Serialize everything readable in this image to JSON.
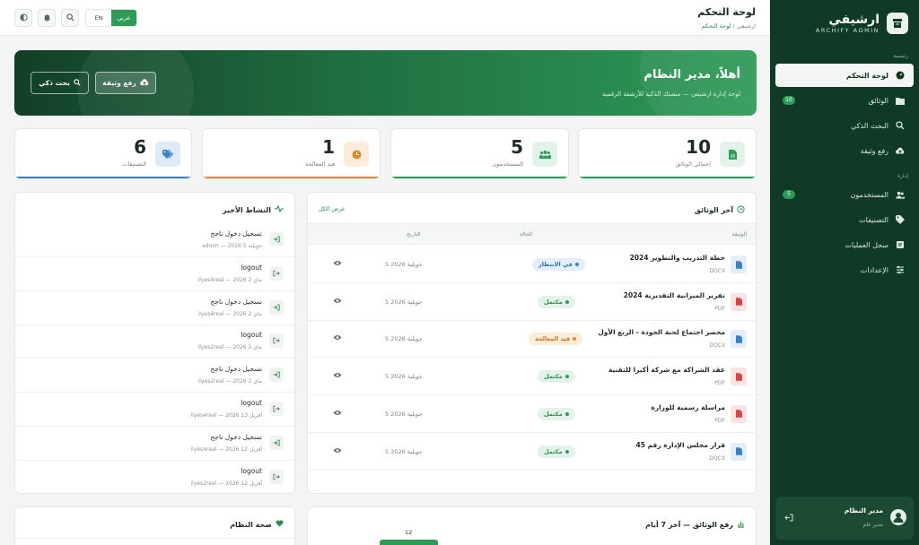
{
  "sidebar": {
    "brand_title": "ارشيفي",
    "brand_sub": "ARCHIFY ADMIN",
    "section_main": "رئيسية",
    "section_admin": "إدارة",
    "items": [
      {
        "label": "لوحة التحكم",
        "icon": "dashboard-icon",
        "active": true
      },
      {
        "label": "الوثائق",
        "icon": "folder-icon",
        "badge": "10"
      },
      {
        "label": "البحث الذكي",
        "icon": "search-icon"
      },
      {
        "label": "رفع وثيقة",
        "icon": "cloud-upload-icon"
      },
      {
        "label": "المستخدمون",
        "icon": "users-icon",
        "badge": "5"
      },
      {
        "label": "التصنيفات",
        "icon": "tag-icon"
      },
      {
        "label": "سجل العمليات",
        "icon": "log-icon"
      },
      {
        "label": "الإعدادات",
        "icon": "sliders-icon"
      }
    ],
    "user": {
      "name": "مدير النظام",
      "role": "مدير عام"
    }
  },
  "topbar": {
    "title": "لوحة التحكم",
    "breadcrumb_root": "ارشيفي",
    "breadcrumb_sep": "/",
    "breadcrumb_current": "لوحة التحكم",
    "lang_ar": "عربي",
    "lang_en": "EN"
  },
  "hero": {
    "title": "أهلاً، مدير النظام",
    "subtitle": "لوحة إدارة ارشيفي — منصتك الذكية للأرشفة الرقمية",
    "upload_label": "رفع وثيقة",
    "search_label": "بحث ذكي"
  },
  "stats": [
    {
      "value": "10",
      "label": "إجمالي الوثائق",
      "color": "#2f9b58",
      "bg": "#e4f3e9"
    },
    {
      "value": "5",
      "label": "المستخدمون",
      "color": "#2f9b58",
      "bg": "#e4f3e9"
    },
    {
      "value": "1",
      "label": "قيد المعالجة",
      "color": "#e08a2e",
      "bg": "#fcecd9"
    },
    {
      "value": "6",
      "label": "التصنيفات",
      "color": "#3b82c4",
      "bg": "#dfeaf7"
    }
  ],
  "documents": {
    "title": "آخر الوثائق",
    "view_all": "عرض الكل",
    "col_doc": "الوثيقة",
    "col_status": "الحالة",
    "col_date": "التاريخ",
    "rows": [
      {
        "name": "خطة التدريب والتطوير 2024",
        "type": "DOCX",
        "status": "في الانتظار",
        "kind": "pending",
        "date": "5 جويلية 2026"
      },
      {
        "name": "تقرير الميزانية التقديرية 2024",
        "type": "PDF",
        "status": "مكتمل",
        "kind": "done",
        "date": "5 جويلية 2026"
      },
      {
        "name": "محضر اجتماع لجنة الجودة - الربع الأول",
        "type": "DOCX",
        "status": "قيد المعالجة",
        "kind": "processing",
        "date": "5 جويلية 2026"
      },
      {
        "name": "عقد الشراكة مع شركة أكيرا للتقنية",
        "type": "PDF",
        "status": "مكتمل",
        "kind": "done",
        "date": "5 جويلية 2026"
      },
      {
        "name": "مراسلة رسمية للوزارة",
        "type": "PDF",
        "status": "مكتمل",
        "kind": "done",
        "date": "5 جويلية 2026"
      },
      {
        "name": "قرار مجلس الإدارة رقم 45",
        "type": "DOCX",
        "status": "مكتمل",
        "kind": "done",
        "date": "5 جويلية 2026"
      }
    ]
  },
  "activity": {
    "title": "النشاط الأخير",
    "rows": [
      {
        "title": "تسجيل دخول ناجح",
        "meta": "admin — 2026 5 جويلية",
        "icon": "login-icon"
      },
      {
        "title": "logout",
        "meta": "ilyes4real — 2026 2 ماي",
        "icon": "logout-icon"
      },
      {
        "title": "تسجيل دخول ناجح",
        "meta": "ilyes4real — 2026 2 ماي",
        "icon": "login-icon"
      },
      {
        "title": "logout",
        "meta": "ilyes2real — 2026 2 ماي",
        "icon": "logout-icon"
      },
      {
        "title": "تسجيل دخول ناجح",
        "meta": "ilyes2real — 2026 2 ماي",
        "icon": "login-icon"
      },
      {
        "title": "logout",
        "meta": "ilyes4real — 2026 13 أفريل",
        "icon": "logout-icon"
      },
      {
        "title": "تسجيل دخول ناجح",
        "meta": "ilyes4real — 2026 12 أفريل",
        "icon": "login-icon"
      },
      {
        "title": "logout",
        "meta": "ilyes2real — 2026 12 أفريل",
        "icon": "logout-icon"
      }
    ]
  },
  "uploads": {
    "title": "رفع الوثائق — آخر 7 أيام",
    "top_value": "12"
  },
  "health": {
    "title": "صحة النظام"
  }
}
